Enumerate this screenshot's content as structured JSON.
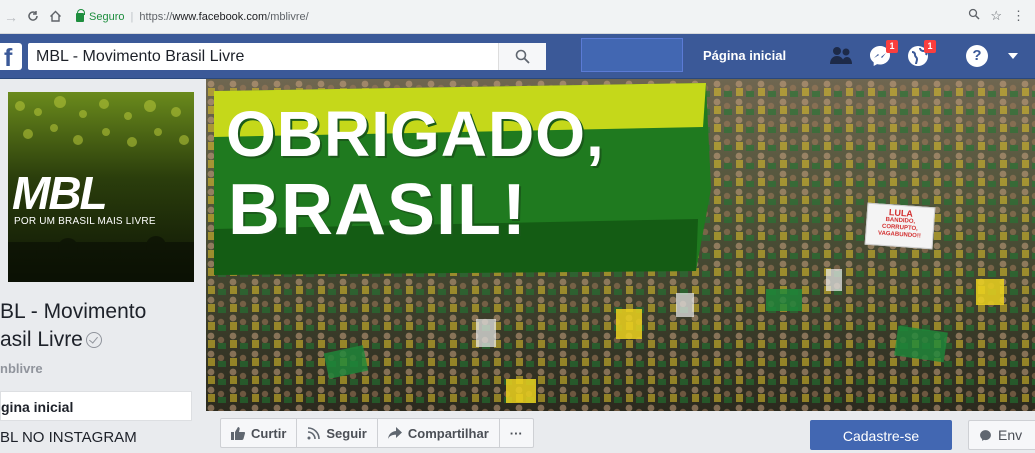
{
  "browser": {
    "security_label": "Seguro",
    "url_prefix": "https://",
    "url_host": "www.facebook.com",
    "url_path": "/mblivre/"
  },
  "topbar": {
    "search_value": "MBL - Movimento Brasil Livre",
    "home_label": "Página inicial",
    "friend_requests_badge": "",
    "messages_badge": "1",
    "notifications_badge": "1",
    "help_glyph": "?"
  },
  "page": {
    "avatar_logo": "MBL",
    "avatar_tagline": "POR UM BRASIL MAIS LIVRE",
    "name_line1": "BL - Movimento",
    "name_line2": "asil Livre",
    "handle": "nblivre",
    "nav": [
      {
        "label": "gina inicial"
      },
      {
        "label": "BL NO INSTAGRAM"
      }
    ]
  },
  "cover": {
    "line1": "OBRIGADO,",
    "line2": "BRASIL!",
    "sign_title": "LULA",
    "sign_text1": "BANDIDO,",
    "sign_text2": "CORRUPTO,",
    "sign_text3": "VAGABUNDO!!"
  },
  "actions": {
    "like_label": "Curtir",
    "follow_label": "Seguir",
    "share_label": "Compartilhar",
    "more_label": "···",
    "signup_label": "Cadastre-se",
    "send_label": "Env"
  },
  "colors": {
    "fb_blue": "#3b5998",
    "signup_blue": "#4267b2",
    "badge_red": "#fa3e3e",
    "banner_green": "#1f7a1f",
    "banner_yellow": "#d7e21a"
  }
}
